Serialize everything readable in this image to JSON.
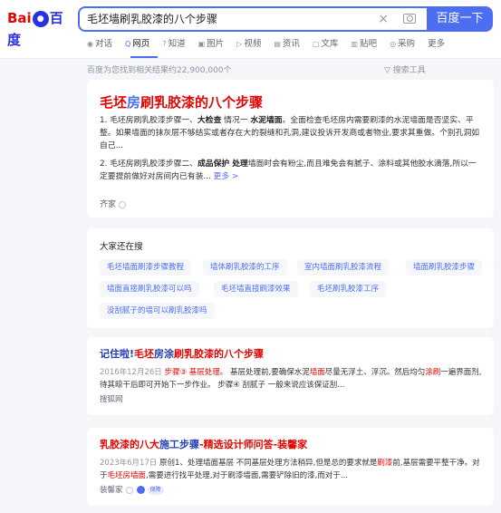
{
  "logo": {
    "bai": "Bai",
    "paw": "●",
    "du": "百度"
  },
  "search": {
    "query": "毛坯墙刷乳胶漆的八个步骤",
    "button": "百度一下",
    "clear": "×"
  },
  "tabs": [
    {
      "icon": "◉",
      "label": "对话"
    },
    {
      "icon": "Q",
      "label": "网页"
    },
    {
      "icon": "?",
      "label": "知道"
    },
    {
      "icon": "▣",
      "label": "图片"
    },
    {
      "icon": "▷",
      "label": "视频"
    },
    {
      "icon": "▤",
      "label": "资讯"
    },
    {
      "icon": "▢",
      "label": "文库"
    },
    {
      "icon": "▥",
      "label": "贴吧"
    },
    {
      "icon": "◎",
      "label": "采购"
    },
    {
      "icon": "",
      "label": "更多"
    }
  ],
  "results_info": "百度为您找到相关结果约22,900,000个",
  "search_tools": "搜索工具",
  "top_card": {
    "title_pre": "毛坯",
    "title_mid": "房",
    "title_post": "刷乳胶漆的八个步骤",
    "item1_a": "1. 毛坯房刷乳胶漆步骤一、",
    "item1_b": "大检查",
    "item1_c": " 情况一 ",
    "item1_d": "水泥墙面",
    "item1_e": "。全面检查毛坯房内需要刷漆的水泥墙面是否坚实、平整。如果墙面的抹灰层不够结实或者存在大的裂缝和孔洞,建议投诉开发商或者物业,要求其重做。个别孔洞如自己...",
    "item2_a": "2. 毛坯房刷乳胶漆步骤二、",
    "item2_b": "成品保护 处理",
    "item2_c": "墙面时会有粉尘,而且难免会有腻子、涂料或其他胶水滴落,所以一定要提前做好对房间内已有装... ",
    "more": "更多 >",
    "source": "齐家"
  },
  "related": {
    "heading": "大家还在搜",
    "chips": [
      "毛坯墙面刷漆步骤教程",
      "墙体刷乳胶漆的工序",
      "室内墙面刷乳胶漆流程",
      "墙面刷乳胶漆步骤",
      "墙面直接刷乳胶漆可以吗",
      "毛坯墙直接刷漆效果",
      "毛坯刷乳胶漆工序",
      "没刮腻子的墙可以刷乳胶漆吗"
    ]
  },
  "result1": {
    "title_a": "记住啦!",
    "title_b": "毛坯",
    "title_c": "房涂",
    "title_d": "刷乳胶漆的八个步骤",
    "date": "2016年12月26日",
    "snippet_a": " 步骤③ 基层处理。",
    "snippet_b": " 基层处理前,要确保水泥",
    "snippet_c": "墙面",
    "snippet_d": "尽量无浮土、浮沉。然后均匀",
    "snippet_e": "涂刷",
    "snippet_f": "一遍界面剂,待其晾干后即可开始下一步作业。 步骤④ 刮腻子 一般来说应该保证刮...",
    "source": "搜狐网"
  },
  "result2": {
    "title_a": "乳胶漆的八大",
    "title_b": "施工步骤",
    "title_c": "-精选设计师问答-装馨家",
    "date": "2023年6月17日",
    "snippet_a": " 原创1、处理墙面基层 不同基层处理方法稍异,但是总的要求就是",
    "snippet_b": "刷漆",
    "snippet_c": "前,基层需要平整干净。对于",
    "snippet_d": "毛坯房墙面",
    "snippet_e": ",需要进行找平处理,对于刷漆墙面,需要铲除旧的漆,而对于...",
    "source": "装馨家",
    "badge": "保障"
  }
}
